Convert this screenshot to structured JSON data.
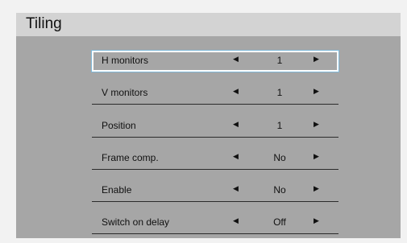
{
  "window": {
    "title": "Tiling"
  },
  "arrows": {
    "left": "◀",
    "right": "▶"
  },
  "menu": {
    "items": [
      {
        "label": "H monitors",
        "value": "1"
      },
      {
        "label": "V monitors",
        "value": "1"
      },
      {
        "label": "Position",
        "value": "1"
      },
      {
        "label": "Frame comp.",
        "value": "No"
      },
      {
        "label": "Enable",
        "value": "No"
      },
      {
        "label": "Switch on delay",
        "value": "Off"
      }
    ]
  }
}
